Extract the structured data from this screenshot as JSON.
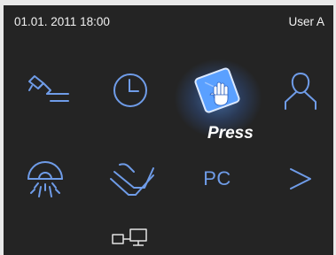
{
  "status_bar": {
    "datetime": "01.01. 2011 18:00",
    "user": "User A"
  },
  "tiles": [
    {
      "icon": "handpiece-icon"
    },
    {
      "icon": "clock-icon"
    },
    {
      "icon": "hand-touch-icon",
      "state": "pressed"
    },
    {
      "icon": "user-icon"
    },
    {
      "icon": "operating-light-icon"
    },
    {
      "icon": "foot-control-icon"
    },
    {
      "icon": "pc-icon",
      "label": "PC"
    },
    {
      "icon": "chevron-right-icon"
    },
    {
      "icon": "network-icon"
    }
  ],
  "press_hint": "Press",
  "colors": {
    "background": "#242424",
    "icon_blue": "#6f9ce8",
    "highlight": "#5aa0ff",
    "frame": "#e9e9e9"
  }
}
